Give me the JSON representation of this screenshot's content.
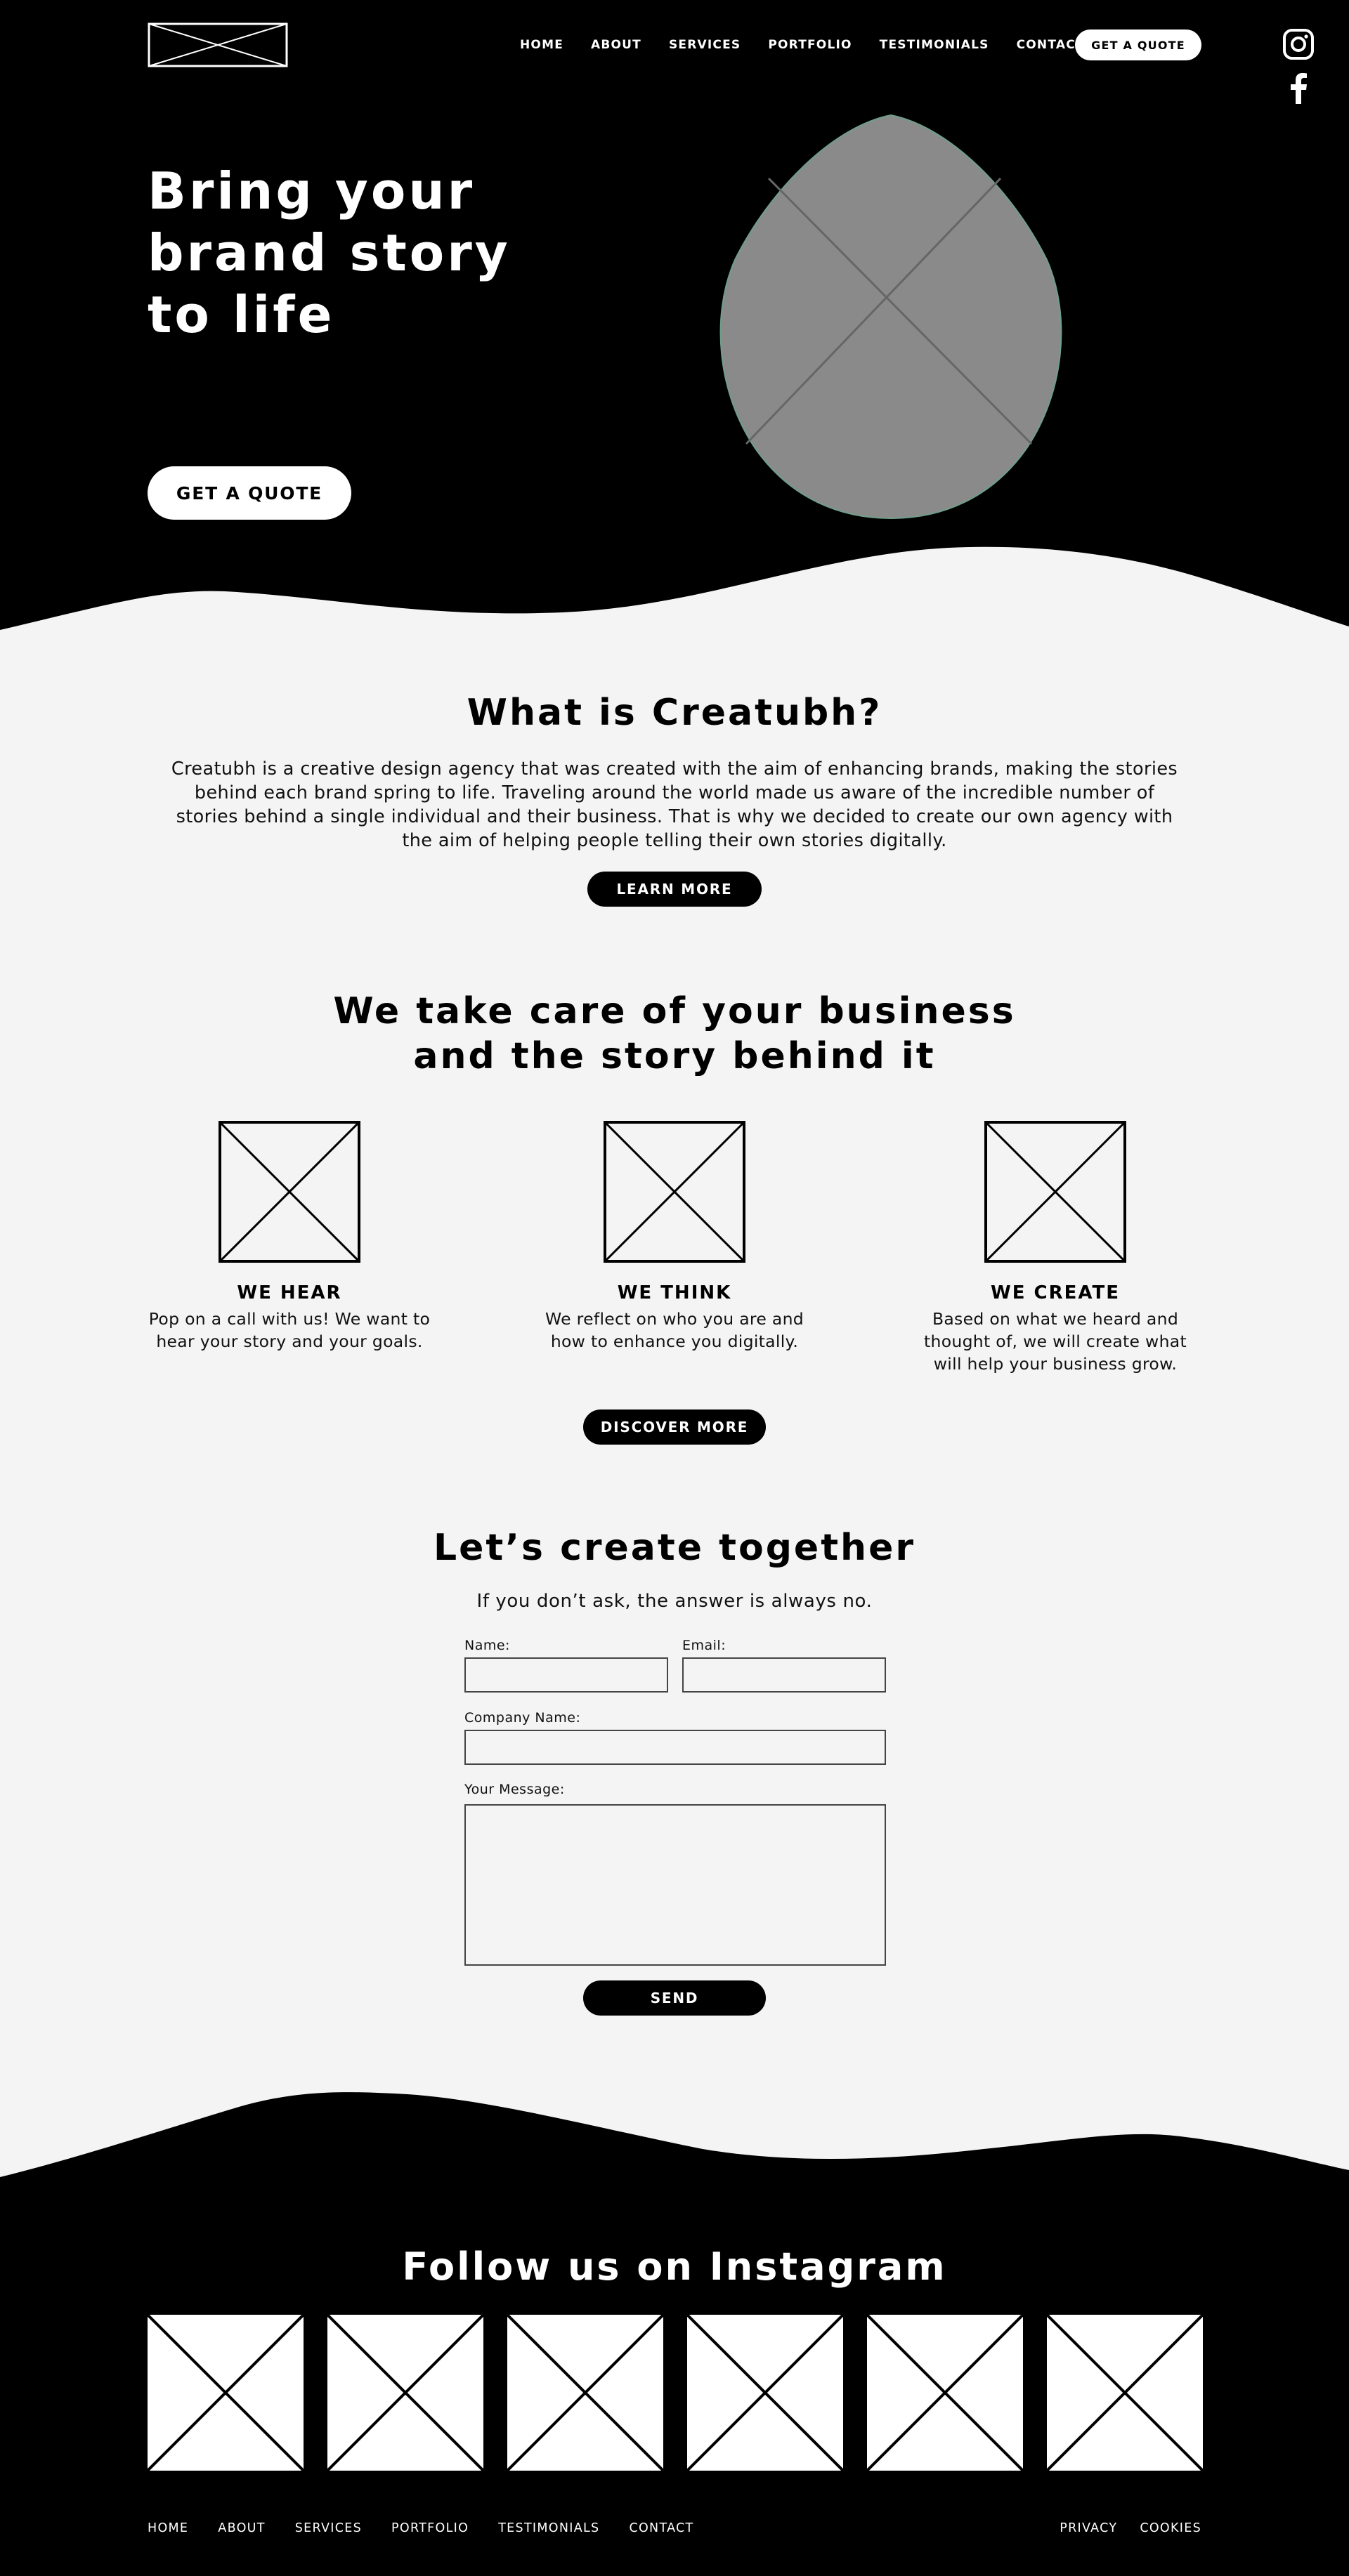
{
  "header": {
    "nav": [
      "HOME",
      "ABOUT",
      "SERVICES",
      "PORTFOLIO",
      "TESTIMONIALS",
      "CONTACT"
    ],
    "quote_button": "GET A QUOTE",
    "social_icons": [
      "instagram-icon",
      "facebook-icon"
    ]
  },
  "hero": {
    "title": "Bring your brand story to life",
    "cta": "GET A QUOTE"
  },
  "about": {
    "title": "What is Creatubh?",
    "text": "Creatubh is a creative design agency that was created with the aim of enhancing brands, making the stories behind each brand spring to life. Traveling around the world made us aware of the incredible number of stories behind a single individual and their business. That is why we decided to create our own agency with the aim of helping people telling their own stories digitally.",
    "button": "LEARN MORE"
  },
  "services": {
    "title": "We take care of your business and the story behind it",
    "items": [
      {
        "title": "WE HEAR",
        "text": "Pop on a call with us! We want to hear your story and your goals."
      },
      {
        "title": "WE THINK",
        "text": "We reflect on who you are and how to enhance you digitally."
      },
      {
        "title": "WE CREATE",
        "text": "Based on what we heard and thought of, we will create what will help your business grow."
      }
    ],
    "button": "DISCOVER MORE"
  },
  "contact": {
    "title": "Let’s create together",
    "subtitle": "If you don’t ask, the answer is always no.",
    "labels": {
      "name": "Name:",
      "email": "Email:",
      "company": "Company Name:",
      "message": "Your Message:"
    },
    "values": {
      "name": "",
      "email": "",
      "company": "",
      "message": ""
    },
    "button": "SEND"
  },
  "footer": {
    "instagram_title": "Follow us on Instagram",
    "nav": [
      "HOME",
      "ABOUT",
      "SERVICES",
      "PORTFOLIO",
      "TESTIMONIALS",
      "CONTACT"
    ],
    "legal": [
      "PRIVACY",
      "COOKIES"
    ]
  },
  "colors": {
    "dark": "#000000",
    "light": "#f4f4f4",
    "placeholder_fill": "#8a8a8a",
    "white": "#ffffff"
  }
}
